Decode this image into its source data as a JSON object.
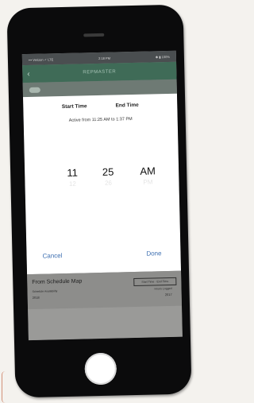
{
  "status_bar": {
    "carrier": "••• Verizon ✓ LTE",
    "time": "2:18 PM",
    "battery": "✱ ▮ 100%"
  },
  "app_bar": {
    "title": "REPMASTER"
  },
  "time_picker": {
    "tab_start": "Start Time",
    "tab_end": "End Time",
    "active_range": "Active from 11:25 AM to 1:37 PM",
    "hour": "11",
    "minute": "25",
    "period": "AM",
    "hour_faint": "12",
    "minute_faint": "26",
    "period_faint": "PM",
    "cancel_label": "Cancel",
    "done_label": "Done"
  },
  "card": {
    "name": "From Schedule Map",
    "pill": "Start Time · End Time",
    "left_label": "Schedule Availability",
    "left_value": "2018",
    "right_label": "Hours Logged",
    "right_value": "2017"
  },
  "colors": {
    "accent": "#3d6fb1",
    "app_bar": "#3f6b57"
  }
}
